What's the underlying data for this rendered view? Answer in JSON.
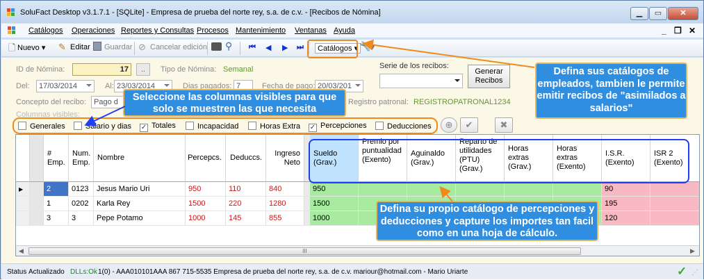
{
  "window": {
    "title": "SoluFact Desktop v3.1.7.1 - [SQLite] - Empresa de prueba del norte rey, s.a. de c.v. - [Recibos de Nómina]"
  },
  "menu": [
    "Catálogos",
    "Operaciones",
    "Reportes y Consultas",
    "Procesos",
    "Mantenimiento",
    "Ventanas",
    "Ayuda"
  ],
  "mdi": {
    "min": "_",
    "restore": "❐",
    "close": "✕"
  },
  "toolbar": {
    "nuevo": "Nuevo",
    "editar": "Editar",
    "guardar": "Guardar",
    "cancelar": "Cancelar edición",
    "catalogos": "Catálogos"
  },
  "form": {
    "id_label": "ID de Nómina:",
    "id_value": "17",
    "id_btn": "..",
    "tipo_label": "Tipo de Nómina:",
    "tipo_value": "Semanal",
    "del_label": "Del:",
    "del_value": "17/03/2014",
    "al_label": "Al:",
    "al_value": "23/03/2014",
    "dias_label": "Dias pagados:",
    "dias_value": "7",
    "fecha_label": "Fecha de pago:",
    "fecha_value": "20/03/201",
    "concepto_label": "Concepto del recibo:",
    "concepto_value": "Pago d",
    "serie_label": "Serie de los recibos:",
    "generar": "Generar Recibos",
    "registro_label": "Registro patronal:",
    "registro_value": "REGISTROPATRONAL1234",
    "columnas_label": "Columnas visibles:"
  },
  "checkboxes": [
    {
      "label": "Generales",
      "checked": false
    },
    {
      "label": "Salario y dias",
      "checked": false
    },
    {
      "label": "Totales",
      "checked": true
    },
    {
      "label": "Incapacidad",
      "checked": false
    },
    {
      "label": "Horas Extra",
      "checked": false
    },
    {
      "label": "Percepciones",
      "checked": true
    },
    {
      "label": "Deducciones",
      "checked": false
    }
  ],
  "grid": {
    "headers": [
      "# Emp.",
      "Num. Emp.",
      "Nombre",
      "Percepcs.",
      "Deduccs.",
      "Ingreso Neto",
      "Sueldo (Grav.)",
      "Premio por puntualidad (Exento)",
      "Aguinaldo (Grav.)",
      "Reparto de utilidades (PTU) (Grav.)",
      "Horas extras (Grav.)",
      "Horas extras (Exento)",
      "I.S.R. (Exento)",
      "ISR 2 (Exento)"
    ],
    "rows": [
      [
        "2",
        "0123",
        "Jesus Mario Uri",
        "950",
        "110",
        "840",
        "950",
        "",
        "",
        "",
        "",
        "",
        "90",
        ""
      ],
      [
        "1",
        "0202",
        "Karla Rey",
        "1500",
        "220",
        "1280",
        "1500",
        "",
        "",
        "",
        "",
        "",
        "195",
        ""
      ],
      [
        "3",
        "3",
        "Pepe Potamo",
        "1000",
        "145",
        "855",
        "1000",
        "",
        "",
        "",
        "",
        "",
        "120",
        ""
      ]
    ],
    "scroll_thumb": "III"
  },
  "callouts": {
    "catalogos": "Defina sus catálogos de empleados, tambien le permite emitir recibos de \"asimilados a salarios\"",
    "columnas": "Seleccione las columnas visibles para que solo se muestren las que necesita",
    "percepciones": "Defina su propio catálogo de percepciones y deducciones y capture los importes tan facil como en una hoja de cálculo."
  },
  "status": {
    "status_label": "Status",
    "state": "Actualizado",
    "dlls": "DLLs:Ok",
    "info": "1(0) - AAA010101AAA  867 715-5535  Empresa de prueba del norte rey, s.a. de c.v.  mariour@hotmail.com - Mario Uriarte"
  },
  "colors": {
    "accent": "#2f8ee0",
    "orange": "#f08a1c",
    "blue_outline": "#1f3ff0",
    "green_cell": "#a7eaa0",
    "pink_cell": "#f9b9c3"
  }
}
